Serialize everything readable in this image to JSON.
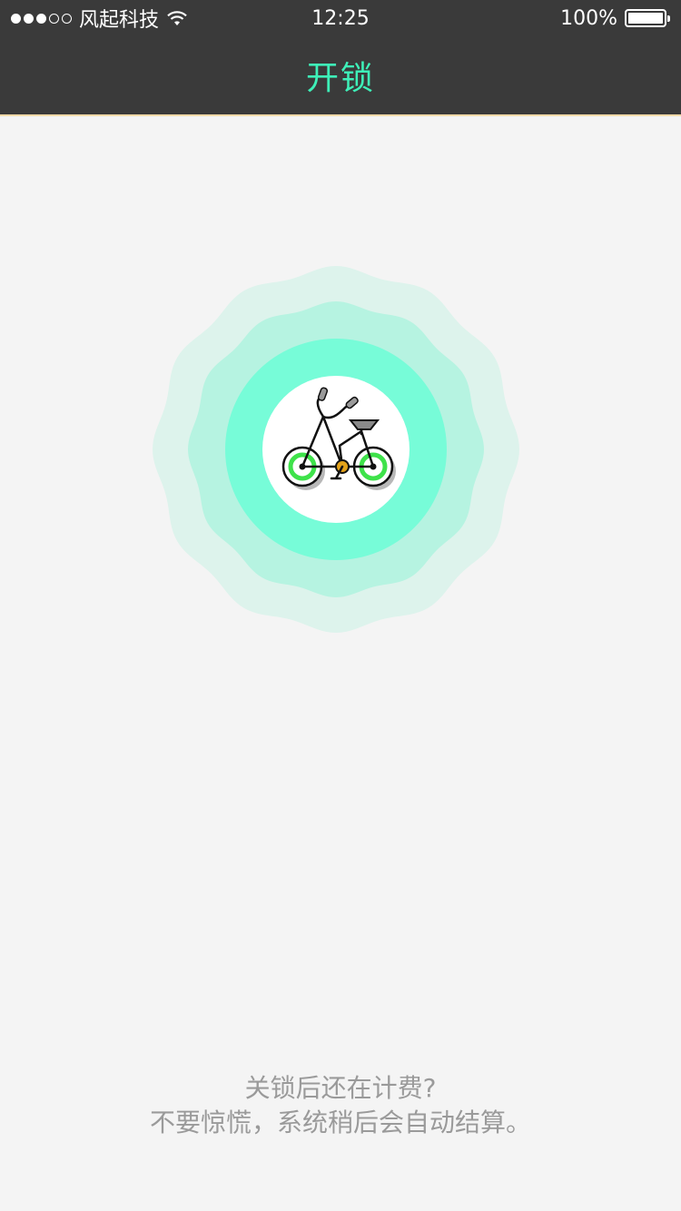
{
  "status_bar": {
    "carrier": "风起科技",
    "time": "12:25",
    "battery": "100%",
    "battery_level": 1.0,
    "signal_bars": 3,
    "signal_total": 5
  },
  "nav": {
    "title": "开锁"
  },
  "scan": {
    "icon": "bicycle-icon",
    "colors": {
      "outer_ring": "#ddf3ec",
      "middle_ring": "#b6f3e1",
      "inner_ring": "#77fcd8",
      "center": "#ffffff",
      "wheel_accent": "#3ee24a"
    }
  },
  "footer": {
    "line1": "关锁后还在计费?",
    "line2": "不要惊慌，系统稍后会自动结算。"
  }
}
